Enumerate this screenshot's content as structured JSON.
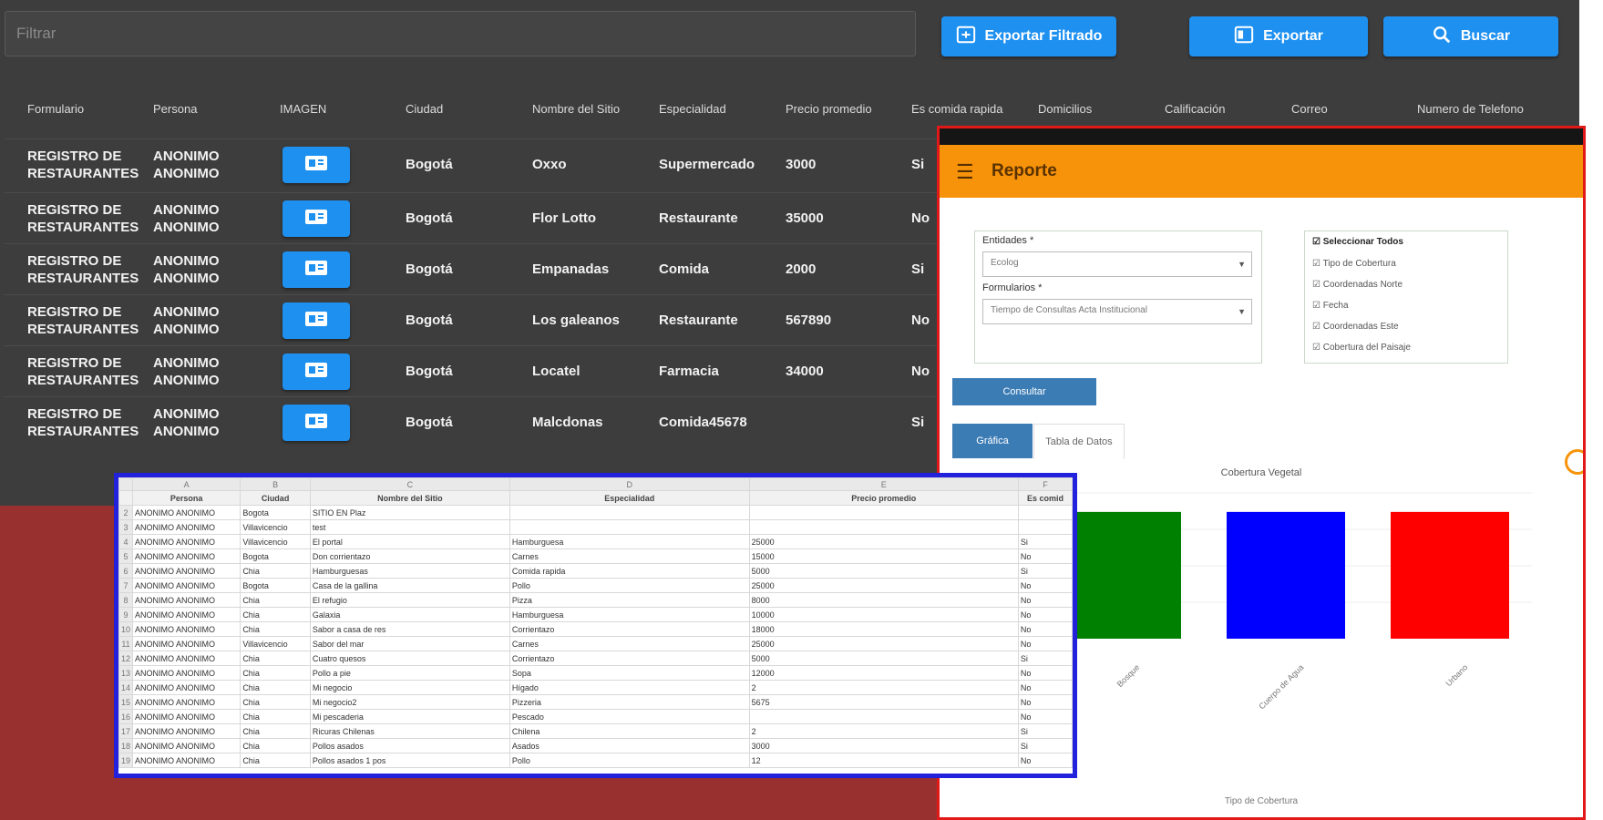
{
  "toolbar": {
    "filter_placeholder": "Filtrar",
    "export_filtered_label": "Exportar Filtrado",
    "export_label": "Exportar",
    "search_label": "Buscar",
    "accent_color": "#1e90f0"
  },
  "table": {
    "headers": [
      "Formulario",
      "Persona",
      "IMAGEN",
      "Ciudad",
      "Nombre del Sitio",
      "Especialidad",
      "Precio promedio",
      "Es comida rapida",
      "Domicilios",
      "Calificación",
      "Correo",
      "Numero de Telefono"
    ],
    "rows": [
      {
        "form1": "REGISTRO DE",
        "form2": "RESTAURANTES",
        "p1": "ANONIMO",
        "p2": "ANONIMO",
        "city": "Bogotá",
        "site": "Oxxo",
        "spec": "Supermercado",
        "price": "3000",
        "fast": "Si"
      },
      {
        "form1": "REGISTRO DE",
        "form2": "RESTAURANTES",
        "p1": "ANONIMO",
        "p2": "ANONIMO",
        "city": "Bogotá",
        "site": "Flor Lotto",
        "spec": "Restaurante",
        "price": "35000",
        "fast": "No"
      },
      {
        "form1": "REGISTRO DE",
        "form2": "RESTAURANTES",
        "p1": "ANONIMO",
        "p2": "ANONIMO",
        "city": "Bogotá",
        "site": "Empanadas",
        "spec": "Comida",
        "price": "2000",
        "fast": "Si"
      },
      {
        "form1": "REGISTRO DE",
        "form2": "RESTAURANTES",
        "p1": "ANONIMO",
        "p2": "ANONIMO",
        "city": "Bogotá",
        "site": "Los galeanos",
        "spec": "Restaurante",
        "price": "567890",
        "fast": "No"
      },
      {
        "form1": "REGISTRO DE",
        "form2": "RESTAURANTES",
        "p1": "ANONIMO",
        "p2": "ANONIMO",
        "city": "Bogotá",
        "site": "Locatel",
        "spec": "Farmacia",
        "price": "34000",
        "fast": "No"
      },
      {
        "form1": "REGISTRO DE",
        "form2": "RESTAURANTES",
        "p1": "ANONIMO",
        "p2": "ANONIMO",
        "city": "Bogotá",
        "site": "Malcdonas",
        "spec": "Comida45678",
        "price": "",
        "fast": "Si"
      }
    ]
  },
  "report": {
    "title": "Reporte",
    "entities_label": "Entidades *",
    "entities_value": "Ecolog",
    "forms_label": "Formularios *",
    "forms_value": "Tiempo de Consultas Acta Institucional",
    "select_all": "Seleccionar Todos",
    "checkbox_items": [
      "Tipo de Cobertura",
      "Coordenadas Norte",
      "Fecha",
      "Coordenadas Este",
      "Cobertura del Paisaje"
    ],
    "consult_button": "Consultar",
    "tab_active": "Gráfica",
    "tab_inactive": "Tabla de Datos",
    "chart_title": "Cobertura Vegetal",
    "footer_label": "Tipo de Cobertura"
  },
  "chart_data": {
    "type": "bar",
    "title": "Cobertura Vegetal",
    "categories": [
      "Bosque",
      "Cuerpo de Agua",
      "Urbano"
    ],
    "values": [
      1,
      1,
      1
    ],
    "colors": [
      "#008000",
      "#0000ff",
      "#ff0000"
    ],
    "ylim": [
      0,
      1.15
    ],
    "xlabel": "Tipo de Cobertura"
  },
  "sheet": {
    "col_letters": [
      "",
      "A",
      "B",
      "C",
      "D",
      "E",
      "F"
    ],
    "headers": [
      "",
      "Persona",
      "Ciudad",
      "Nombre del Sitio",
      "Especialidad",
      "Precio promedio",
      "Es comid"
    ],
    "rows": [
      [
        "2",
        "ANONIMO ANONIMO",
        "Bogota",
        "SITIO EN Plaz",
        "",
        "",
        ""
      ],
      [
        "3",
        "ANONIMO ANONIMO",
        "Villavicencio",
        "test",
        "",
        "",
        ""
      ],
      [
        "4",
        "ANONIMO ANONIMO",
        "Villavicencio",
        "El portal",
        "Hamburguesa",
        "25000",
        "Si"
      ],
      [
        "5",
        "ANONIMO ANONIMO",
        "Bogota",
        "Don corrientazo",
        "Carnes",
        "15000",
        "No"
      ],
      [
        "6",
        "ANONIMO ANONIMO",
        "Chia",
        "Hamburguesas",
        "Comida rapida",
        "5000",
        "Si"
      ],
      [
        "7",
        "ANONIMO ANONIMO",
        "Bogota",
        "Casa de la gallina",
        "Pollo",
        "25000",
        "No"
      ],
      [
        "8",
        "ANONIMO ANONIMO",
        "Chia",
        "El refugio",
        "Pizza",
        "8000",
        "No"
      ],
      [
        "9",
        "ANONIMO ANONIMO",
        "Chia",
        "Galaxia",
        "Hamburguesa",
        "10000",
        "No"
      ],
      [
        "10",
        "ANONIMO ANONIMO",
        "Chia",
        "Sabor a casa de res",
        "Corrientazo",
        "18000",
        "No"
      ],
      [
        "11",
        "ANONIMO ANONIMO",
        "Villavicencio",
        "Sabor del mar",
        "Carnes",
        "25000",
        "No"
      ],
      [
        "12",
        "ANONIMO ANONIMO",
        "Chia",
        "Cuatro quesos",
        "Corrientazo",
        "5000",
        "Si"
      ],
      [
        "13",
        "ANONIMO ANONIMO",
        "Chia",
        "Pollo a pie",
        "Sopa",
        "12000",
        "No"
      ],
      [
        "14",
        "ANONIMO ANONIMO",
        "Chia",
        "Mi negocio",
        "Hígado",
        "2",
        "No"
      ],
      [
        "15",
        "ANONIMO ANONIMO",
        "Chia",
        "Mi negocio2",
        "Pizzeria",
        "5675",
        "No"
      ],
      [
        "16",
        "ANONIMO ANONIMO",
        "Chia",
        "Mi pescaderia",
        "Pescado",
        "",
        "No"
      ],
      [
        "17",
        "ANONIMO ANONIMO",
        "Chia",
        "Ricuras Chilenas",
        "Chilena",
        "2",
        "Si"
      ],
      [
        "18",
        "ANONIMO ANONIMO",
        "Chia",
        "Pollos asados",
        "Asados",
        "3000",
        "Si"
      ],
      [
        "19",
        "ANONIMO ANONIMO",
        "Chia",
        "Pollos asados 1 pos",
        "Pollo",
        "12",
        "No"
      ]
    ]
  }
}
